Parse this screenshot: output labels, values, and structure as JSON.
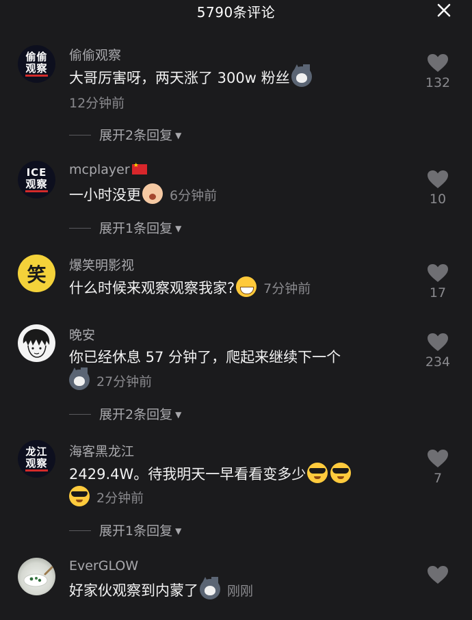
{
  "header": {
    "title": "5790条评论"
  },
  "comments": [
    {
      "avatar": {
        "line1": "偷偷",
        "line2": "观察"
      },
      "username": "偷偷观察",
      "text": "大哥厉害呀，两天涨了 300w 粉丝",
      "emoji": "husky-face-emoji",
      "time": "12分钟前",
      "expand": "展开2条回复",
      "likes": "132"
    },
    {
      "avatar": {
        "line1": "ICE",
        "line2": "观察"
      },
      "username": "mcplayer",
      "flag": "china-flag",
      "text": "一小时没更",
      "emoji": "crying-cat-emoji",
      "time": "6分钟前",
      "expand": "展开1条回复",
      "likes": "10"
    },
    {
      "avatar": {
        "glyph": "笑"
      },
      "username": "爆笑明影视",
      "text": "什么时候来观察观察我家?",
      "emoji": "grinning-sweat-emoji",
      "time": "7分钟前",
      "likes": "17"
    },
    {
      "avatar": {
        "style": "anime-sketch"
      },
      "username": "晚安",
      "text": "你已经休息 57 分钟了，爬起来继续下一个",
      "emoji": "husky-face-emoji",
      "time": "27分钟前",
      "expand": "展开2条回复",
      "likes": "234"
    },
    {
      "avatar": {
        "line1": "龙江",
        "line2": "观察"
      },
      "username": "海客黑龙江",
      "text": "2429.4W。待我明天一早看看变多少",
      "emoji": "sunglasses-emoji",
      "time": "2分钟前",
      "expand": "展开1条回复",
      "likes": "7"
    },
    {
      "avatar": {
        "style": "food-bowl-photo"
      },
      "username": "EverGLOW",
      "text": "好家伙观察到内蒙了",
      "emoji": "husky-face-emoji",
      "time": "刚刚",
      "likes": ""
    }
  ],
  "colors": {
    "background": "#1b1b1d",
    "username": "#a9a9ad",
    "meta": "#8a8a8e",
    "text": "#f2f2f2"
  }
}
